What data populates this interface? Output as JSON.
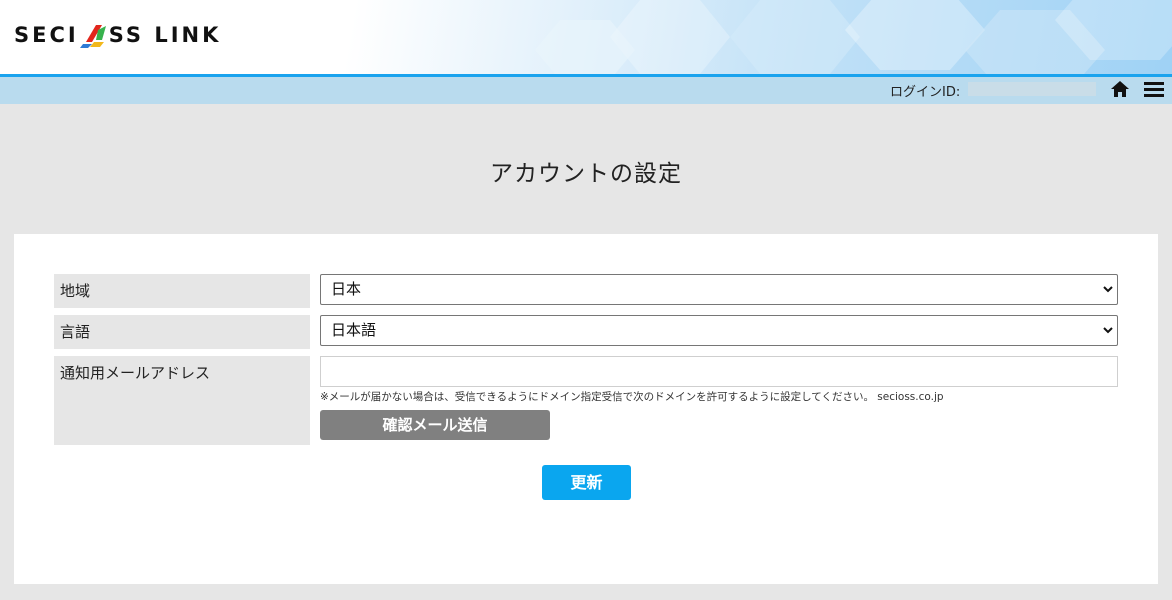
{
  "header": {
    "logo_left": "SECI",
    "logo_right": "SS LINK",
    "login_label": "ログインID:",
    "icons": [
      "home-icon",
      "menu-icon"
    ]
  },
  "page": {
    "title": "アカウントの設定"
  },
  "form": {
    "region": {
      "label": "地域",
      "value": "日本"
    },
    "language": {
      "label": "言語",
      "value": "日本語"
    },
    "email": {
      "label": "通知用メールアドレス",
      "value": "",
      "note": "※メールが届かない場合は、受信できるようにドメイン指定受信で次のドメインを許可するように設定してください。 secioss.co.jp",
      "confirm_button": "確認メール送信"
    },
    "update_button": "更新"
  },
  "colors": {
    "header_accent": "#1aa3ee",
    "subbar": "#b9dbee",
    "update_button": "#0aa6ef",
    "confirm_button": "#808080"
  }
}
